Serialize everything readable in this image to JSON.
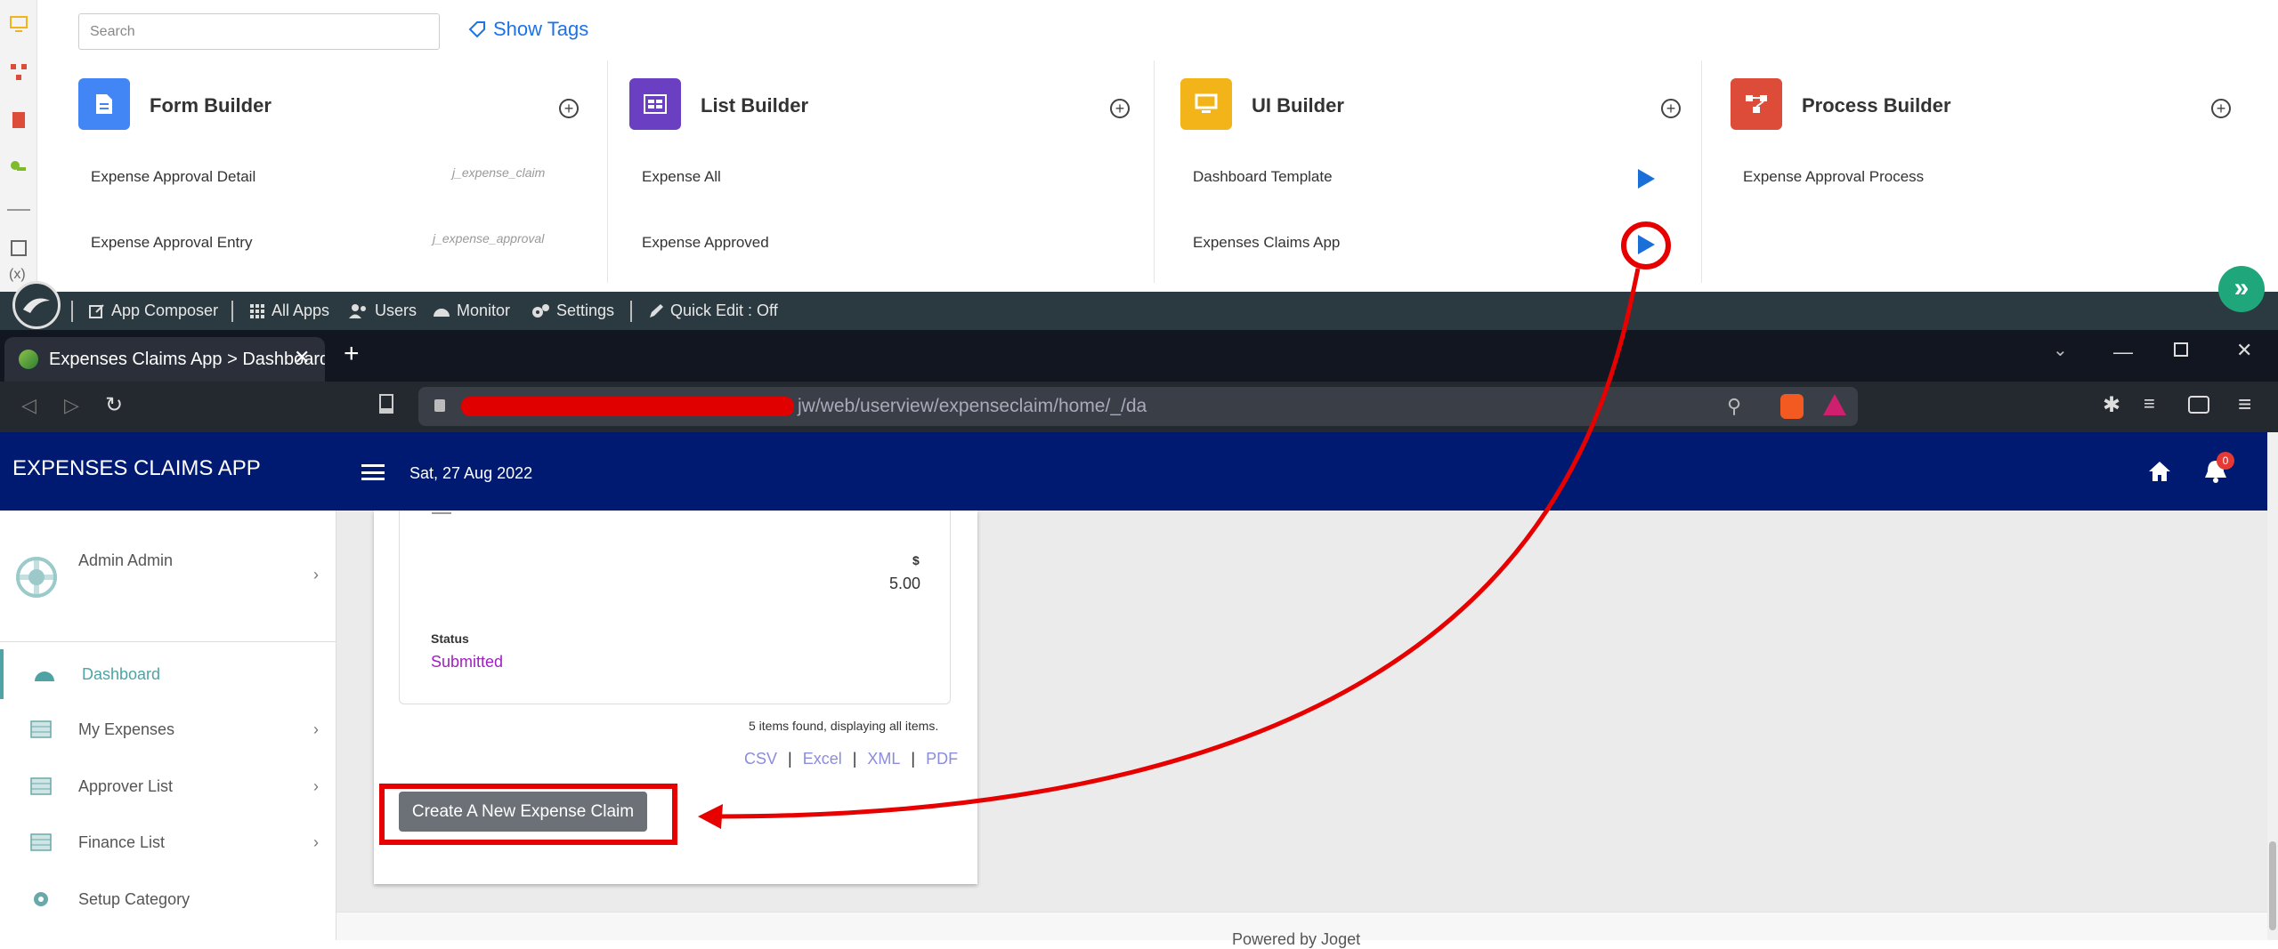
{
  "top": {
    "search_placeholder": "Search",
    "show_tags": "Show Tags",
    "builders": [
      {
        "title": "Form Builder",
        "color": "#4285f4",
        "items": [
          {
            "label": "Expense Approval Detail",
            "tag": "j_expense_claim"
          },
          {
            "label": "Expense Approval Entry",
            "tag": "j_expense_approval"
          }
        ]
      },
      {
        "title": "List Builder",
        "color": "#6a3fc1",
        "items": [
          {
            "label": "Expense All",
            "tag": ""
          },
          {
            "label": "Expense Approved",
            "tag": ""
          }
        ]
      },
      {
        "title": "UI Builder",
        "color": "#f2b418",
        "items": [
          {
            "label": "Dashboard Template",
            "tag": ""
          },
          {
            "label": "Expenses Claims App",
            "tag": ""
          }
        ]
      },
      {
        "title": "Process Builder",
        "color": "#dd4b39",
        "items": [
          {
            "label": "Expense Approval Process",
            "tag": ""
          }
        ]
      }
    ]
  },
  "toolbar": {
    "app_composer": "App Composer",
    "all_apps": "All Apps",
    "users": "Users",
    "monitor": "Monitor",
    "settings": "Settings",
    "quick_edit": "Quick Edit : Off"
  },
  "browser": {
    "tab_title": "Expenses Claims App > Dashboard",
    "url": "jw/web/userview/expenseclaim/home/_/da"
  },
  "app": {
    "title": "EXPENSES CLAIMS APP",
    "date": "Sat, 27 Aug 2022",
    "notification_count": "0",
    "user": "Admin Admin",
    "nav": [
      {
        "label": "Dashboard",
        "icon": "dashboard-icon"
      },
      {
        "label": "My Expenses",
        "icon": "list-icon"
      },
      {
        "label": "Approver List",
        "icon": "list-icon"
      },
      {
        "label": "Finance List",
        "icon": "list-icon"
      },
      {
        "label": "Setup Category",
        "icon": "gear-icon"
      }
    ],
    "amount_currency": "$",
    "amount_value": "5.00",
    "status_label": "Status",
    "status_value": "Submitted",
    "items_found": "5 items found, displaying all items.",
    "exports": [
      "CSV",
      "Excel",
      "XML",
      "PDF"
    ],
    "create_button": "Create A New Expense Claim",
    "powered_by": "Powered by Joget"
  },
  "colors": {
    "header": "#001a72",
    "annotation": "#e60000",
    "status": "#a020c0",
    "accent_teal": "#4fa3a5"
  }
}
